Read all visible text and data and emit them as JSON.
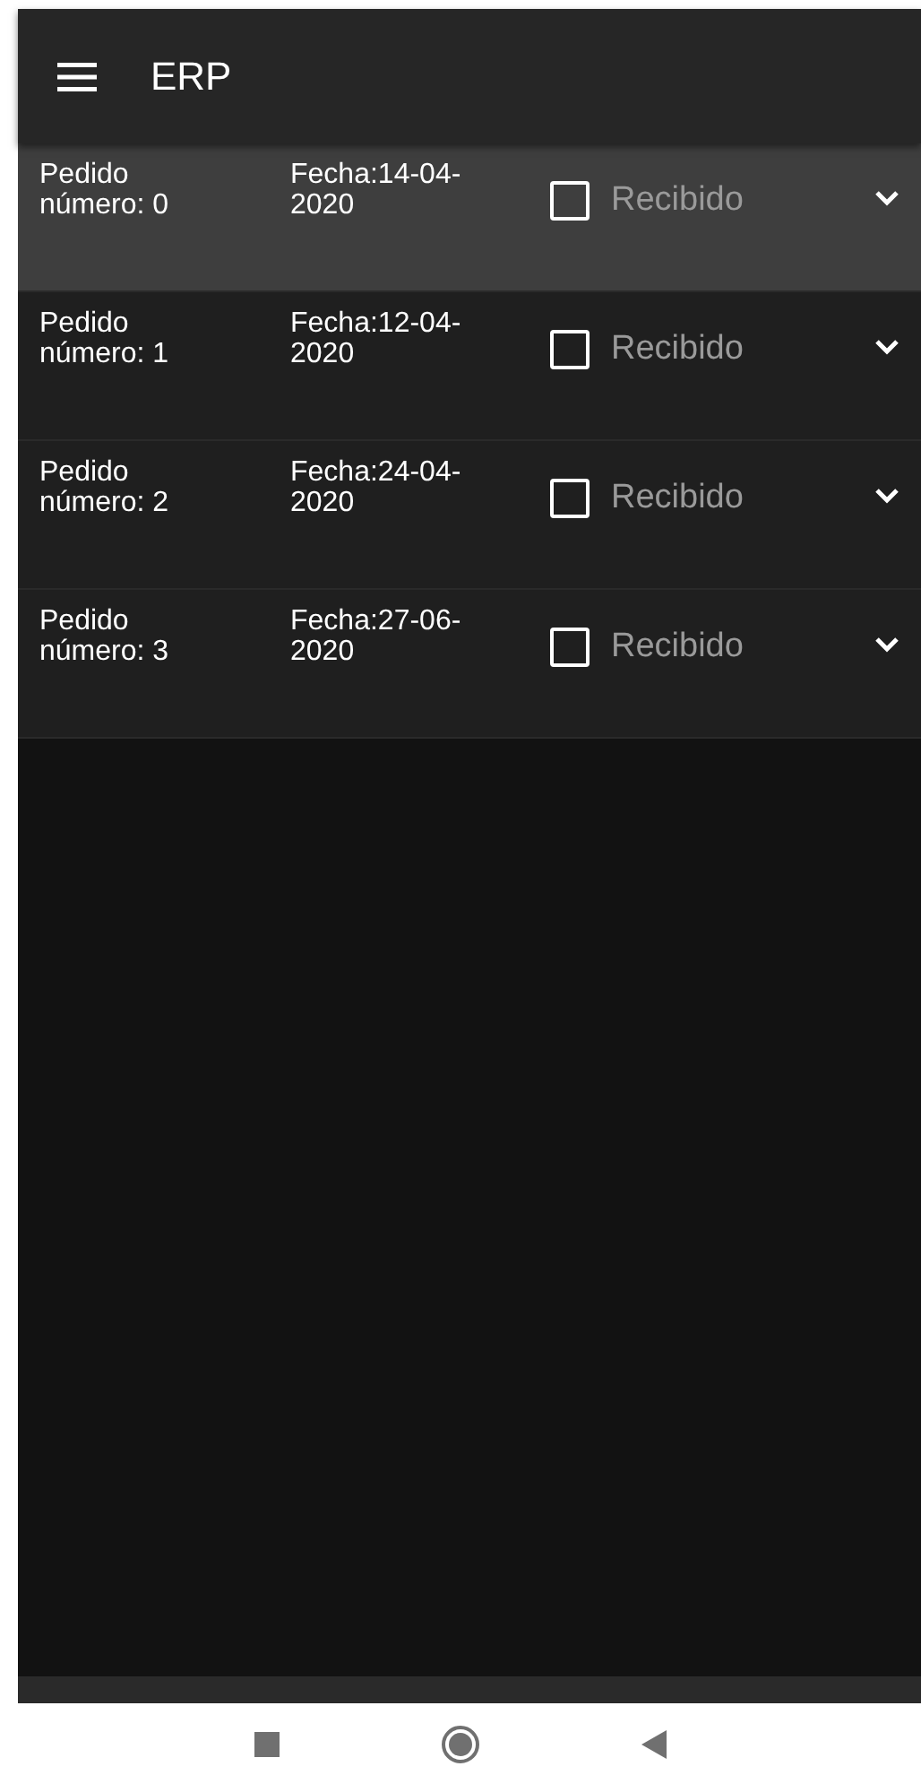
{
  "app_bar": {
    "title": "ERP"
  },
  "orders": [
    {
      "order": "Pedido número: 0",
      "date": "Fecha:14-04-2020",
      "received_label": "Recibido",
      "checked": false,
      "selected": true
    },
    {
      "order": "Pedido número: 1",
      "date": "Fecha:12-04-2020",
      "received_label": "Recibido",
      "checked": false,
      "selected": false
    },
    {
      "order": "Pedido número: 2",
      "date": "Fecha:24-04-2020",
      "received_label": "Recibido",
      "checked": false,
      "selected": false
    },
    {
      "order": "Pedido número: 3",
      "date": "Fecha:27-06-2020",
      "received_label": "Recibido",
      "checked": false,
      "selected": false
    }
  ]
}
